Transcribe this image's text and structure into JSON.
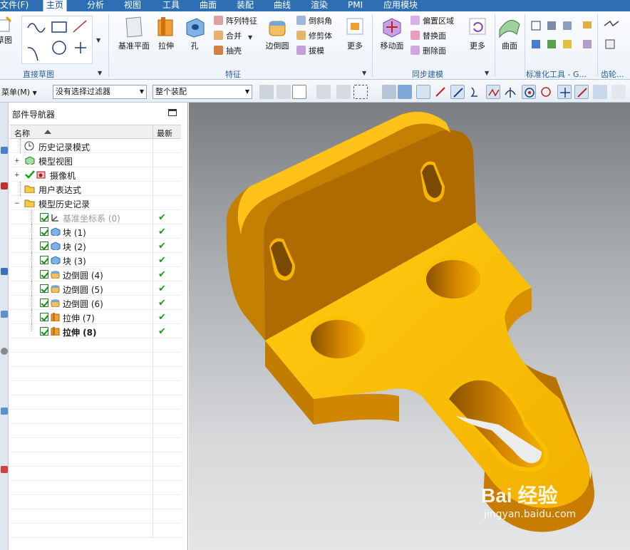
{
  "tabs": [
    {
      "label": "文件(F)"
    },
    {
      "label": "主页"
    },
    {
      "label": "分析"
    },
    {
      "label": "视图"
    },
    {
      "label": "工具"
    },
    {
      "label": "曲面"
    },
    {
      "label": "装配"
    },
    {
      "label": "曲线"
    },
    {
      "label": "渲染"
    },
    {
      "label": "PMI"
    },
    {
      "label": "应用模块"
    }
  ],
  "ribbon": {
    "sketch": {
      "partial_label": "草图",
      "group": "直接草图"
    },
    "feature": {
      "datum_plane": "基准平面",
      "extrude": "拉伸",
      "hole": "孔",
      "pattern": "阵列特征",
      "unite": "合并",
      "shell": "抽壳",
      "edge_blend": "边倒圆",
      "chamfer": "倒斜角",
      "trim_body": "修剪体",
      "draft": "拔模",
      "more": "更多",
      "group": "特征"
    },
    "sync": {
      "move_face": "移动面",
      "offset_region": "偏置区域",
      "replace_face": "替换面",
      "delete_face": "删除面",
      "more": "更多",
      "group": "同步建模"
    },
    "surface": {
      "label": "曲面"
    },
    "standard_tools": {
      "group": "标准化工具 - G..."
    },
    "gear": {
      "group": "齿轮..."
    }
  },
  "toolbar": {
    "menu": "菜单(M)",
    "filter": "没有选择过滤器",
    "scope": "整个装配"
  },
  "navigator": {
    "title": "部件导航器",
    "col_name": "名称",
    "col_latest": "最新",
    "rows": [
      {
        "label": "历史记录模式"
      },
      {
        "label": "模型视图"
      },
      {
        "label": "摄像机"
      },
      {
        "label": "用户表达式"
      },
      {
        "label": "模型历史记录"
      },
      {
        "label": "基准坐标系 (0)"
      },
      {
        "label": "块 (1)"
      },
      {
        "label": "块 (2)"
      },
      {
        "label": "块 (3)"
      },
      {
        "label": "边倒圆 (4)"
      },
      {
        "label": "边倒圆 (5)"
      },
      {
        "label": "边倒圆 (6)"
      },
      {
        "label": "拉伸 (7)"
      },
      {
        "label": "拉伸 (8)"
      }
    ],
    "latest_mark": "✔"
  },
  "watermark": {
    "brand": "Bai 经验",
    "url": "jingyan.baidu.com"
  },
  "colors": {
    "part": "#f5b400",
    "part_dark": "#c98700",
    "accent": "#2e6fb3",
    "check": "#18a018"
  }
}
